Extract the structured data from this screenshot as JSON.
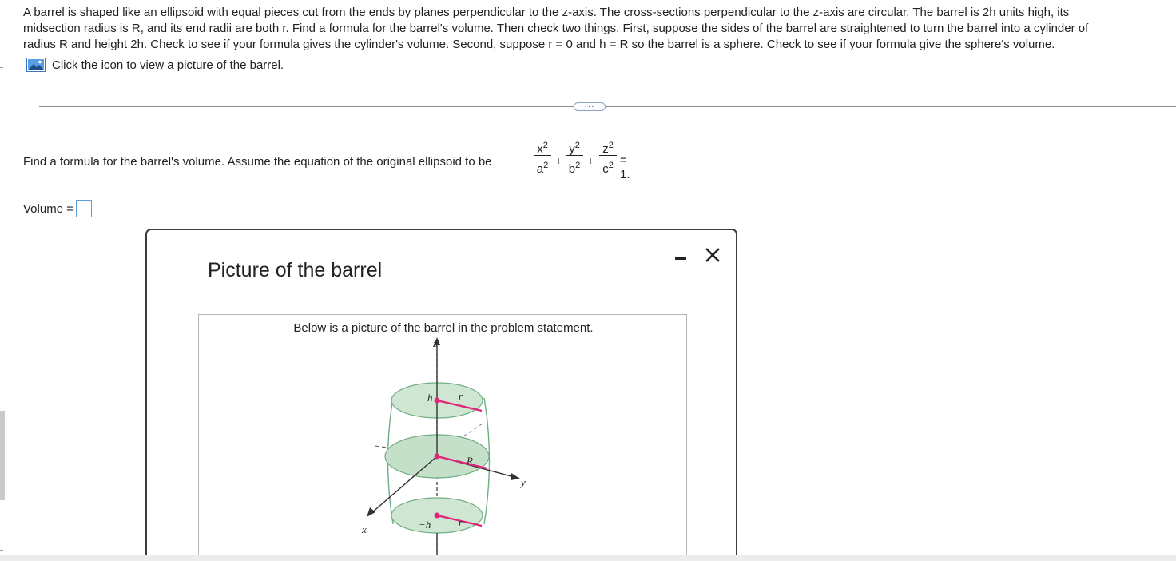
{
  "problem": {
    "lines": [
      "A barrel is shaped like an ellipsoid with equal pieces cut from the ends by planes perpendicular to the z-axis. The cross-sections perpendicular to the z-axis are circular. The barrel is 2h units high, its",
      "midsection radius is R, and its end radii are both r. Find a formula for the barrel's volume. Then check two things. First, suppose the sides of the barrel are straightened to turn the barrel into a cylinder of",
      "radius R and height 2h. Check to see if your formula gives the cylinder's volume. Second, suppose r = 0 and h = R so the barrel is a sphere. Check to see if your formula give the sphere's volume."
    ],
    "picture_link": "Click the icon to view a picture of the barrel.",
    "picture_icon": "image-icon"
  },
  "more_button": {
    "label": "···"
  },
  "question": {
    "text": "Find a formula for the barrel's volume. Assume the equation of the original ellipsoid to be",
    "formula": {
      "t1_num": "x",
      "t1_den": "a",
      "t2_num": "y",
      "t2_den": "b",
      "t3_num": "z",
      "t3_den": "c",
      "exponent": "2",
      "plus": "+",
      "rhs": "= 1."
    }
  },
  "answer": {
    "label": "Volume =",
    "value": ""
  },
  "modal": {
    "title": "Picture of the barrel",
    "minimize_icon": "minimize-icon",
    "close_icon": "close-icon",
    "figure": {
      "caption": "Below is a picture of the barrel in the problem statement.",
      "labels": {
        "z": "z",
        "y": "y",
        "x": "x",
        "h": "h",
        "neg_h": "−h",
        "r_top": "r",
        "r_bottom": "r",
        "R": "R"
      },
      "colors": {
        "disk_fill": "#cfe6d2",
        "disk_edge": "#6fae85",
        "radius": "#e0267a",
        "axis": "#333333"
      }
    }
  }
}
